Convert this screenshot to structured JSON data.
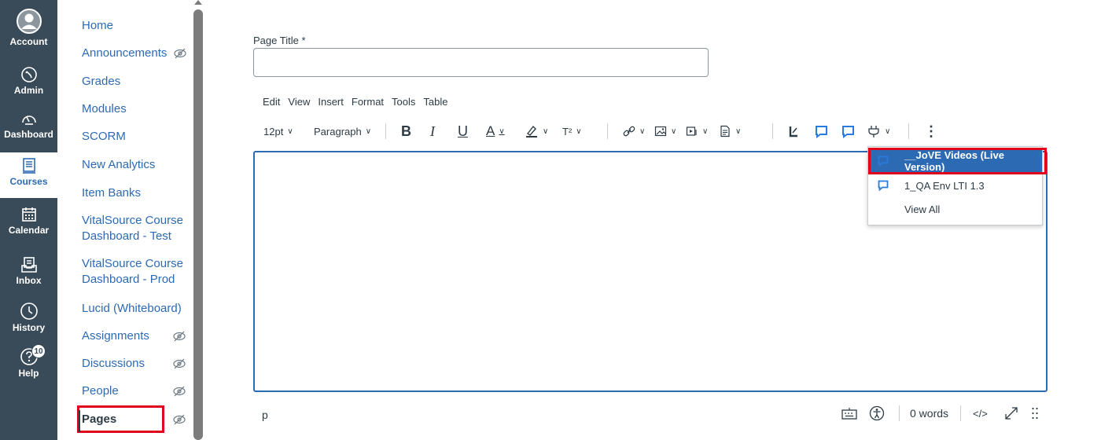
{
  "global_nav": {
    "items": [
      {
        "label": "Account",
        "icon": "account-icon"
      },
      {
        "label": "Admin",
        "icon": "admin-shield-icon"
      },
      {
        "label": "Dashboard",
        "icon": "dashboard-gauge-icon"
      },
      {
        "label": "Courses",
        "icon": "courses-book-icon"
      },
      {
        "label": "Calendar",
        "icon": "calendar-icon"
      },
      {
        "label": "Inbox",
        "icon": "inbox-icon"
      },
      {
        "label": "History",
        "icon": "history-clock-icon"
      },
      {
        "label": "Help",
        "icon": "help-icon"
      }
    ],
    "help_badge": "10"
  },
  "course_nav": {
    "items": [
      {
        "label": "Home"
      },
      {
        "label": "Announcements",
        "hidden": true
      },
      {
        "label": "Grades"
      },
      {
        "label": "Modules"
      },
      {
        "label": "SCORM"
      },
      {
        "label": "New Analytics"
      },
      {
        "label": "Item Banks"
      },
      {
        "label": "VitalSource Course Dashboard - Test"
      },
      {
        "label": "VitalSource Course Dashboard - Prod"
      },
      {
        "label": "Lucid (Whiteboard)"
      },
      {
        "label": "Assignments",
        "hidden": true
      },
      {
        "label": "Discussions",
        "hidden": true
      },
      {
        "label": "People",
        "hidden": true
      },
      {
        "label": "Pages",
        "hidden": true
      }
    ]
  },
  "editor": {
    "title_label": "Page Title",
    "title_required": "*",
    "title_value": "",
    "menubar": [
      "Edit",
      "View",
      "Insert",
      "Format",
      "Tools",
      "Table"
    ],
    "toolbar": {
      "font_size": "12pt",
      "block_format": "Paragraph",
      "bold": "B",
      "italic": "I",
      "underline": "U",
      "font_color": "A",
      "superscript": "T²"
    },
    "status": {
      "element_path": "p",
      "word_count": "0 words",
      "html_toggle": "</>"
    }
  },
  "apps_dropdown": {
    "items": [
      {
        "label": "__JoVE Videos (Live Version)",
        "selected": true
      },
      {
        "label": "1_QA Env LTI 1.3",
        "selected": false
      },
      {
        "label": "View All",
        "selected": false
      }
    ]
  },
  "colors": {
    "global_nav_bg": "#394b58",
    "link_blue": "#2d6ab4",
    "highlight_red": "#e0001b",
    "text": "#2d3b45"
  }
}
